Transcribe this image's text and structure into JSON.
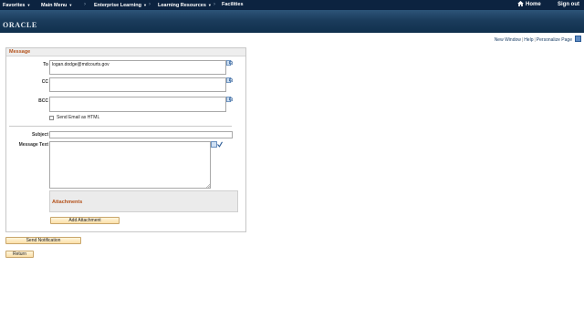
{
  "topnav": {
    "favorites": "Favorites",
    "main_menu": "Main Menu",
    "breadcrumbs": [
      "Enterprise Learning",
      "Learning Resources",
      "Facilities"
    ],
    "home": "Home",
    "sign_out": "Sign out"
  },
  "banner": {
    "logo": "ORACLE"
  },
  "pagelinks": {
    "new_window": "New Window",
    "help": "Help",
    "personalize": "Personalize Page"
  },
  "message": {
    "header": "Message",
    "to_label": "To",
    "to_value": "logan.dodge@mdcourts.gov",
    "cc_label": "CC",
    "cc_value": "",
    "bcc_label": "BCC",
    "bcc_value": "",
    "html_checkbox_label": "Send Email as HTML",
    "html_checked": false,
    "subject_label": "Subject",
    "subject_value": "",
    "text_label": "Message Text",
    "text_value": "",
    "attachments_title": "Attachments",
    "add_attachment": "Add Attachment"
  },
  "actions": {
    "send_notification": "Send Notification",
    "return": "Return"
  },
  "colors": {
    "nav_bg": "#0c2340",
    "section_title": "#b4511a",
    "button_bg": "#fbdfa8"
  }
}
